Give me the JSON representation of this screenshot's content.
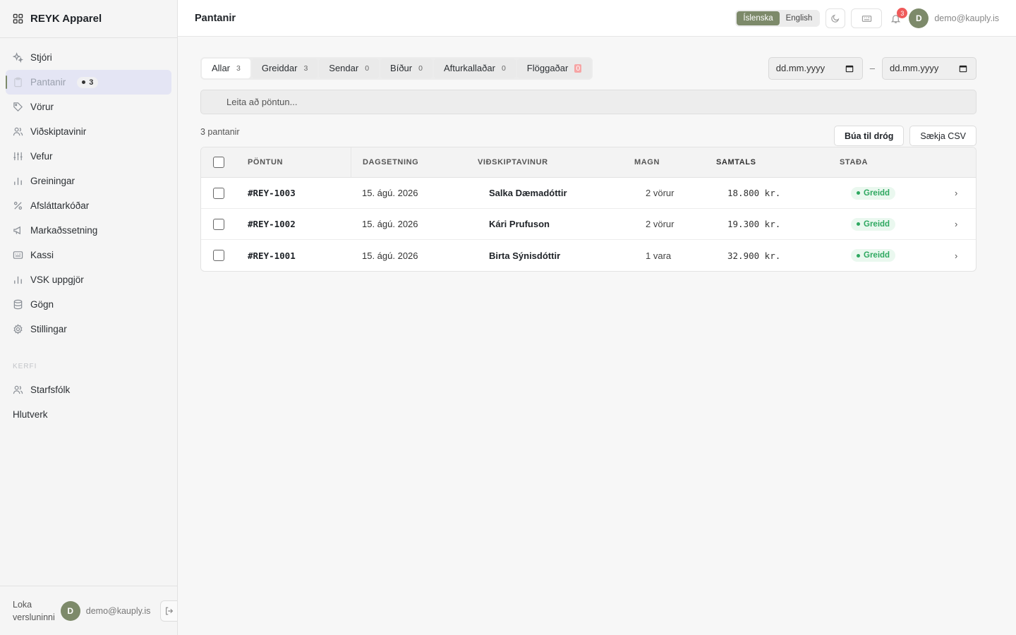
{
  "brand": {
    "name": "REYK Apparel"
  },
  "sidebar": {
    "items": [
      {
        "label": "Stjóri",
        "icon": "sparkle-icon"
      },
      {
        "label": "Pantanir",
        "icon": "clipboard-icon",
        "badge": "3"
      },
      {
        "label": "Vörur",
        "icon": "tag-icon"
      },
      {
        "label": "Viðskiptavinir",
        "icon": "users-icon"
      },
      {
        "label": "Vefur",
        "icon": "sliders-icon"
      },
      {
        "label": "Greiningar",
        "icon": "bar-chart-icon"
      },
      {
        "label": "Afsláttarkóðar",
        "icon": "percent-icon"
      },
      {
        "label": "Markaðssetning",
        "icon": "megaphone-icon"
      },
      {
        "label": "Kassi",
        "icon": "register-icon"
      },
      {
        "label": "VSK uppgjör",
        "icon": "bar-chart-icon"
      },
      {
        "label": "Gögn",
        "icon": "database-icon"
      },
      {
        "label": "Stillingar",
        "icon": "gear-icon"
      }
    ],
    "section_label": "KERFI",
    "system_items": [
      {
        "label": "Starfsfólk",
        "icon": "users-icon"
      },
      {
        "label": "Hlutverk"
      }
    ],
    "footer": {
      "close_store": "Loka versluninni",
      "avatar": "D",
      "email": "demo@kauply.is"
    }
  },
  "header": {
    "title": "Pantanir",
    "lang_is": "Íslenska",
    "lang_en": "English",
    "notifications": "3",
    "avatar": "D",
    "email": "demo@kauply.is"
  },
  "tabs": [
    {
      "label": "Allar",
      "count": "3"
    },
    {
      "label": "Greiddar",
      "count": "3"
    },
    {
      "label": "Sendar",
      "count": "0"
    },
    {
      "label": "Bíður",
      "count": "0"
    },
    {
      "label": "Afturkallaðar",
      "count": "0"
    },
    {
      "label": "Flöggaðar",
      "count": "0"
    }
  ],
  "date_from": {
    "placeholder": "dd.mm.yyyy"
  },
  "date_sep": "–",
  "date_to": {
    "placeholder": "dd.mm.yyyy"
  },
  "search": {
    "placeholder": "Leita að pöntun..."
  },
  "list": {
    "count_text": "3 pantanir",
    "draft_button": "Búa til dróg",
    "csv_button": "Sækja CSV"
  },
  "table": {
    "columns": {
      "order": "PÖNTUN",
      "date": "DAGSETNING",
      "customer": "VIÐSKIPTAVINUR",
      "qty": "MAGN",
      "total": "SAMTALS",
      "status": "STAÐA"
    },
    "rows": [
      {
        "order": "#REY-1003",
        "date": "15. ágú. 2026",
        "customer": "Salka Dæmadóttir",
        "qty": "2 vörur",
        "total": "18.800 kr.",
        "status": "Greidd"
      },
      {
        "order": "#REY-1002",
        "date": "15. ágú. 2026",
        "customer": "Kári Prufuson",
        "qty": "2 vörur",
        "total": "19.300 kr.",
        "status": "Greidd"
      },
      {
        "order": "#REY-1001",
        "date": "15. ágú. 2026",
        "customer": "Birta Sýnisdóttir",
        "qty": "1 vara",
        "total": "32.900 kr.",
        "status": "Greidd"
      }
    ]
  },
  "colors": {
    "accent": "#7d8a6a",
    "status_paid": "#2ea860",
    "notification": "#ef5a5a"
  }
}
